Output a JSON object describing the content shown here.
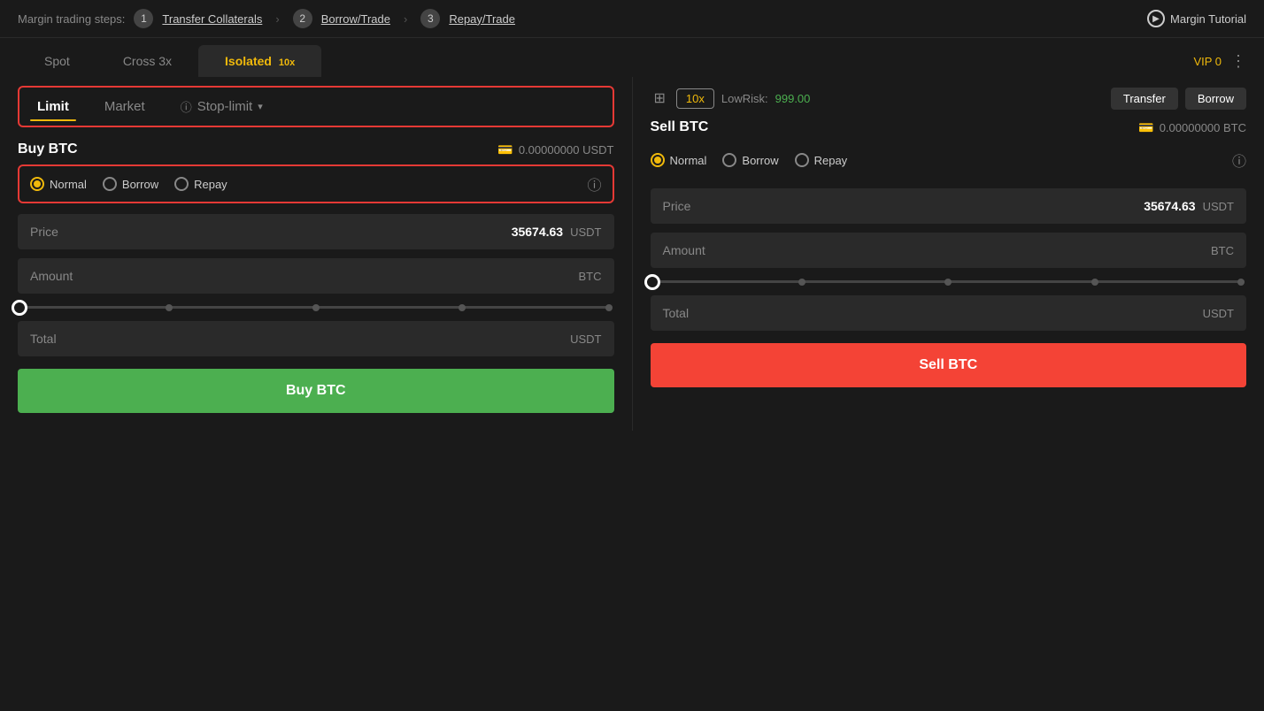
{
  "topbar": {
    "label": "Margin trading steps:",
    "step1_num": "1",
    "step1_label": "Transfer Collaterals",
    "step2_num": "2",
    "step2_label": "Borrow/Trade",
    "step3_num": "3",
    "step3_label": "Repay/Trade",
    "tutorial_label": "Margin Tutorial"
  },
  "tabs": {
    "spot": "Spot",
    "cross": "Cross 3x",
    "isolated": "Isolated",
    "isolated_badge": "10x",
    "vip": "VIP 0"
  },
  "toolbar": {
    "leverage": "10x",
    "low_risk_label": "LowRisk:",
    "low_risk_value": "999.00",
    "transfer_label": "Transfer",
    "borrow_label": "Borrow"
  },
  "order_types": {
    "limit": "Limit",
    "market": "Market",
    "stop_limit": "Stop-limit"
  },
  "buy_panel": {
    "title": "Buy BTC",
    "balance": "0.00000000 USDT",
    "radio_normal": "Normal",
    "radio_borrow": "Borrow",
    "radio_repay": "Repay",
    "price_label": "Price",
    "price_value": "35674.63",
    "price_currency": "USDT",
    "amount_label": "Amount",
    "amount_currency": "BTC",
    "total_label": "Total",
    "total_currency": "USDT",
    "btn_label": "Buy BTC"
  },
  "sell_panel": {
    "title": "Sell BTC",
    "balance": "0.00000000 BTC",
    "radio_normal": "Normal",
    "radio_borrow": "Borrow",
    "radio_repay": "Repay",
    "price_label": "Price",
    "price_value": "35674.63",
    "price_currency": "USDT",
    "amount_label": "Amount",
    "amount_currency": "BTC",
    "total_label": "Total",
    "total_currency": "USDT",
    "btn_label": "Sell BTC"
  },
  "colors": {
    "gold": "#f0b90b",
    "green": "#4caf50",
    "red": "#f44336",
    "highlight_border": "#e53935"
  }
}
